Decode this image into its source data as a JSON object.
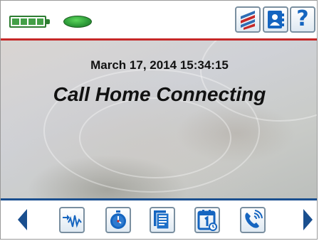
{
  "status": {
    "battery_level": 1.0,
    "indicator_color": "#2f9e3a",
    "datetime": "March 17, 2014 15:34:15",
    "message": "Call Home Connecting"
  },
  "toolbar": {
    "buttons": [
      {
        "icon": "network-icon"
      },
      {
        "icon": "contact-icon"
      },
      {
        "icon": "help-icon",
        "glyph": "?"
      }
    ]
  },
  "nav": {
    "buttons": [
      {
        "icon": "waveform-icon"
      },
      {
        "icon": "timer-icon"
      },
      {
        "icon": "documents-icon"
      },
      {
        "icon": "calendar-icon"
      },
      {
        "icon": "phone-call-icon"
      }
    ]
  },
  "colors": {
    "accent_red": "#c62828",
    "accent_blue": "#1a4f8f",
    "icon_blue": "#1565c0"
  }
}
